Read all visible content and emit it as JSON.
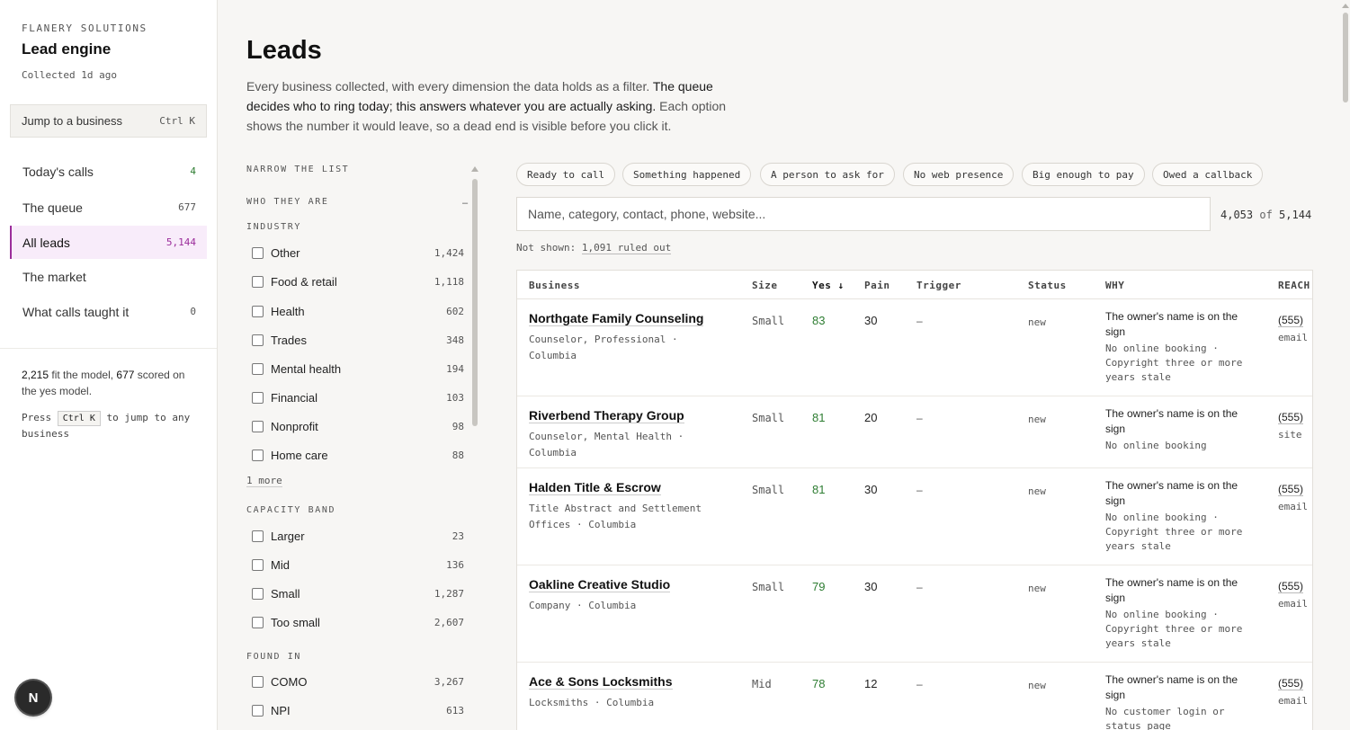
{
  "sidebar": {
    "org": "FLANERY SOLUTIONS",
    "title": "Lead engine",
    "collected": "Collected 1d ago",
    "jump": {
      "label": "Jump to a business",
      "shortcut": "Ctrl K"
    },
    "nav": [
      {
        "label": "Today's calls",
        "count": "4"
      },
      {
        "label": "The queue",
        "count": "677"
      },
      {
        "label": "All leads",
        "count": "5,144"
      },
      {
        "label": "The market",
        "count": ""
      },
      {
        "label": "What calls taught it",
        "count": "0"
      }
    ],
    "stats": {
      "fit": "2,215",
      "fit_text": " fit the model, ",
      "scored": "677",
      "scored_text": " scored on the yes model."
    },
    "hint": {
      "before": "Press ",
      "kbd": "Ctrl K",
      "after": " to jump to any business"
    },
    "badge": "N"
  },
  "header": {
    "title": "Leads",
    "intro_1": "Every business collected, with every dimension the data holds as a filter. ",
    "intro_2": "The queue decides who to ring today; this answers whatever you are actually asking.",
    "intro_3": " Each option shows the number it would leave, so a dead end is visible before you click it."
  },
  "filters": {
    "heading": "NARROW THE LIST",
    "group": "WHO THEY ARE",
    "collapse": "–",
    "industry": {
      "title": "INDUSTRY",
      "options": [
        {
          "label": "Other",
          "count": "1,424"
        },
        {
          "label": "Food & retail",
          "count": "1,118"
        },
        {
          "label": "Health",
          "count": "602"
        },
        {
          "label": "Trades",
          "count": "348"
        },
        {
          "label": "Mental health",
          "count": "194"
        },
        {
          "label": "Financial",
          "count": "103"
        },
        {
          "label": "Nonprofit",
          "count": "98"
        },
        {
          "label": "Home care",
          "count": "88"
        }
      ],
      "more": "1 more"
    },
    "capacity": {
      "title": "CAPACITY BAND",
      "options": [
        {
          "label": "Larger",
          "count": "23"
        },
        {
          "label": "Mid",
          "count": "136"
        },
        {
          "label": "Small",
          "count": "1,287"
        },
        {
          "label": "Too small",
          "count": "2,607"
        }
      ]
    },
    "found_in": {
      "title": "FOUND IN",
      "options": [
        {
          "label": "COMO",
          "count": "3,267"
        },
        {
          "label": "NPI",
          "count": "613"
        }
      ]
    }
  },
  "chips": [
    "Ready to call",
    "Something happened",
    "A person to ask for",
    "No web presence",
    "Big enough to pay",
    "Owed a callback"
  ],
  "search": {
    "placeholder": "Name, category, contact, phone, website...",
    "value": ""
  },
  "result": {
    "shown": "4,053",
    "of": "of",
    "total": "5,144"
  },
  "not_shown": {
    "label": "Not shown: ",
    "link": "1,091 ruled out"
  },
  "table": {
    "columns": [
      "Business",
      "Size",
      "Yes ↓",
      "Pain",
      "Trigger",
      "Status",
      "WHY",
      "REACH"
    ],
    "rows": [
      {
        "name": "Northgate Family Counseling",
        "meta": "Counselor, Professional · Columbia",
        "size": "Small",
        "yes": "83",
        "pain": "30",
        "trigger": "–",
        "status": "new",
        "why": "The owner's name is on the sign",
        "why_sub": "No online booking · Copyright three or more years stale",
        "phone": "(555)",
        "channel": "email"
      },
      {
        "name": "Riverbend Therapy Group",
        "meta": "Counselor, Mental Health · Columbia",
        "size": "Small",
        "yes": "81",
        "pain": "20",
        "trigger": "–",
        "status": "new",
        "why": "The owner's name is on the sign",
        "why_sub": "No online booking",
        "phone": "(555)",
        "channel": "site"
      },
      {
        "name": "Halden Title & Escrow",
        "meta": "Title Abstract and Settlement Offices · Columbia",
        "size": "Small",
        "yes": "81",
        "pain": "30",
        "trigger": "–",
        "status": "new",
        "why": "The owner's name is on the sign",
        "why_sub": "No online booking · Copyright three or more years stale",
        "phone": "(555)",
        "channel": "email"
      },
      {
        "name": "Oakline Creative Studio",
        "meta": "Company · Columbia",
        "size": "Small",
        "yes": "79",
        "pain": "30",
        "trigger": "–",
        "status": "new",
        "why": "The owner's name is on the sign",
        "why_sub": "No online booking · Copyright three or more years stale",
        "phone": "(555)",
        "channel": "email"
      },
      {
        "name": "Ace & Sons Locksmiths",
        "meta": "Locksmiths · Columbia",
        "size": "Mid",
        "yes": "78",
        "pain": "12",
        "trigger": "–",
        "status": "new",
        "why": "The owner's name is on the sign",
        "why_sub": "No customer login or status page",
        "phone": "(555)",
        "channel": "email"
      }
    ]
  }
}
